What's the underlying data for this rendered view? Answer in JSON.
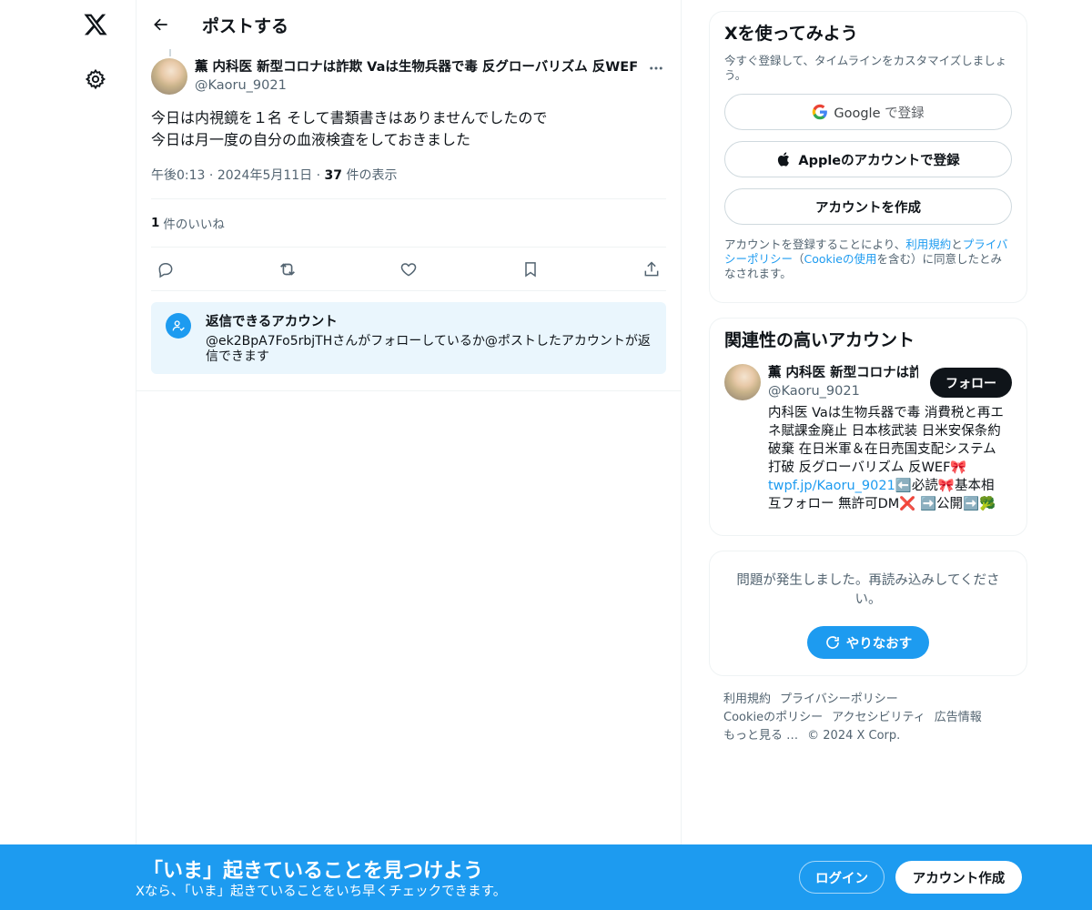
{
  "nav": {
    "logo_icon": "x-logo-icon",
    "settings_icon": "gear-icon"
  },
  "header": {
    "title": "ポストする"
  },
  "tweet": {
    "author_name": "薫 内科医 新型コロナは詐欺 Vaは生物兵器で毒 反グローバリズム 反WEF",
    "author_handle": "@Kaoru_9021",
    "body_line1": "今日は内視鏡を１名 そして書類書きはありませんでしたので",
    "body_line2": "今日は月一度の自分の血液検査をしておきました",
    "time": "午後0:13",
    "date": "2024年5月11日",
    "views_count": "37",
    "views_label": "件の表示",
    "likes_count": "1",
    "likes_label": "件のいいね"
  },
  "reply_notice": {
    "title": "返信できるアカウント",
    "desc": "@ek2BpA7Fo5rbjTHさんがフォローしているか@ポストしたアカウントが返信できます"
  },
  "signup_card": {
    "title": "Xを使ってみよう",
    "subtitle": "今すぐ登録して、タイムラインをカスタマイズしましょう。",
    "google_label": "Google",
    "google_suffix": "で登録",
    "apple_label": "Appleのアカウントで登録",
    "create_label": "アカウントを作成",
    "legal_prefix": "アカウントを登録することにより、",
    "legal_terms": "利用規約",
    "legal_and": "と",
    "legal_privacy": "プライバシーポリシー",
    "legal_paren_open": "（",
    "legal_cookie": "Cookieの使用",
    "legal_suffix": "を含む）に同意したとみなされます。"
  },
  "related": {
    "title": "関連性の高いアカウント",
    "name": "薫 内科医 新型コロナは詐欺 Vaは生物兵器で毒",
    "handle": "@Kaoru_9021",
    "follow_label": "フォロー",
    "bio_text": "内科医 Vaは生物兵器で毒 消費税と再エネ賦課金廃止 日本核武装 日米安保条約破棄 在日米軍＆在日売国支配システム打破 反グローバリズム 反WEF🎀",
    "bio_link": "twpf.jp/Kaoru_9021",
    "bio_tail": "⬅️必読🎀基本相互フォロー 無許可DM❌ ➡️公開➡️🥦"
  },
  "error_card": {
    "message": "問題が発生しました。再読み込みしてください。",
    "retry_label": "やりなおす"
  },
  "footer": {
    "links": [
      "利用規約",
      "プライバシーポリシー",
      "Cookieのポリシー",
      "アクセシビリティ",
      "広告情報",
      "もっと見る …"
    ],
    "copyright": "© 2024 X Corp."
  },
  "banner": {
    "title": "「いま」起きていることを見つけよう",
    "subtitle": "Xなら、「いま」起きていることをいち早くチェックできます。",
    "login_label": "ログイン",
    "signup_label": "アカウント作成"
  },
  "colors": {
    "accent": "#1d9bf0",
    "text": "#0f1419",
    "muted": "#536471",
    "border": "#eff3f4"
  }
}
